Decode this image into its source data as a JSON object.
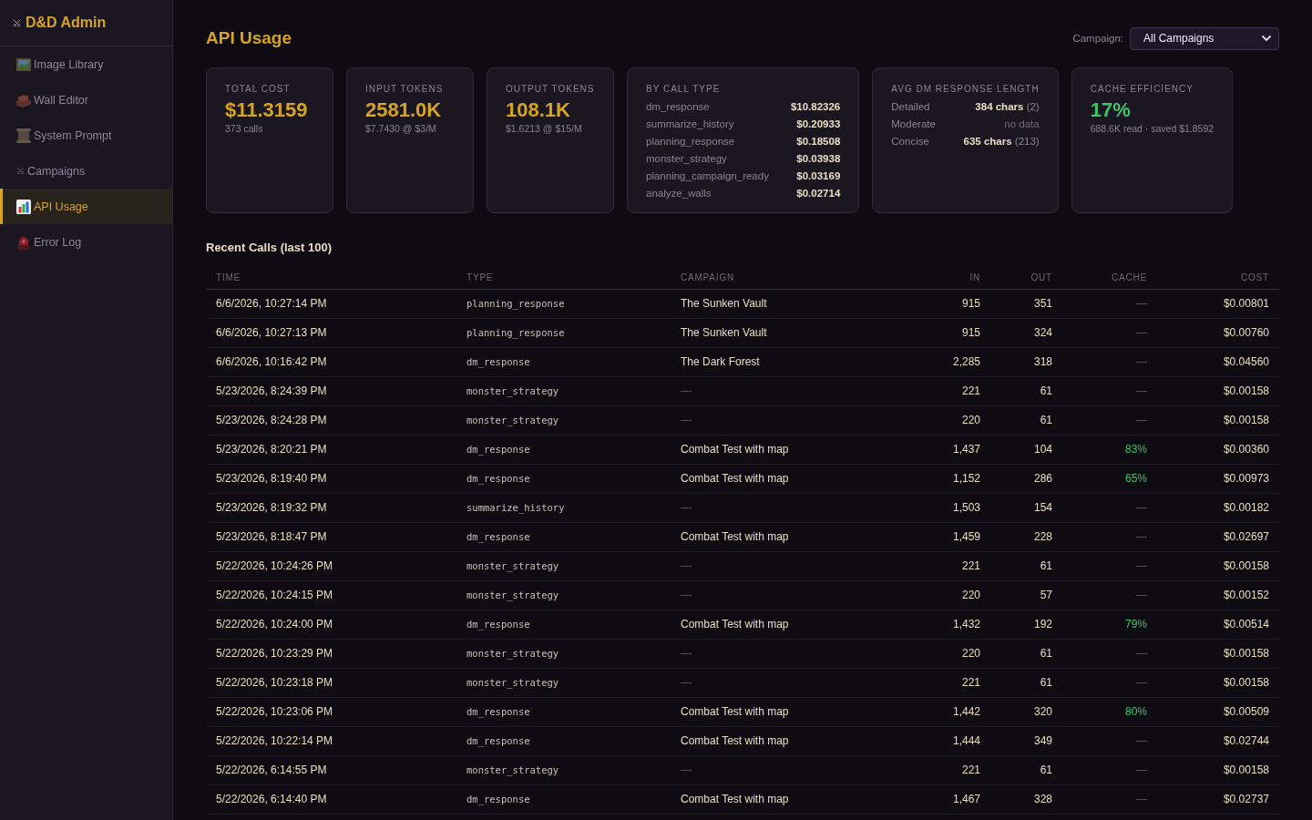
{
  "sidebar": {
    "brand": "D&D Admin",
    "items": [
      {
        "label": "Image Library",
        "selected": false
      },
      {
        "label": "Wall Editor",
        "selected": false
      },
      {
        "label": "System Prompt",
        "selected": false
      },
      {
        "label": "Campaigns",
        "selected": false
      },
      {
        "label": "API Usage",
        "selected": true
      },
      {
        "label": "Error Log",
        "selected": false
      }
    ]
  },
  "header": {
    "title": "API Usage",
    "campaign_filter": {
      "label": "Campaign:",
      "value": "All Campaigns"
    }
  },
  "stats": [
    {
      "kind": "metric",
      "label": "TOTAL COST",
      "value": "$11.3159",
      "note": "373 calls",
      "color": "#d6a324"
    },
    {
      "kind": "metric",
      "label": "INPUT TOKENS",
      "value": "2581.0K",
      "note": "$7.7430 @ $3/M",
      "color": "#d6a324"
    },
    {
      "kind": "metric",
      "label": "OUTPUT TOKENS",
      "value": "108.1K",
      "note": "$1.6213 @ $15/M",
      "color": "#d6a324"
    },
    {
      "kind": "breakdown",
      "label": "BY CALL TYPE",
      "rows": [
        {
          "name": "dm_response",
          "cost": "$10.82326"
        },
        {
          "name": "summarize_history",
          "cost": "$0.20933"
        },
        {
          "name": "planning_response",
          "cost": "$0.18508"
        },
        {
          "name": "monster_strategy",
          "cost": "$0.03938"
        },
        {
          "name": "planning_campaign_ready",
          "cost": "$0.03169"
        },
        {
          "name": "analyze_walls",
          "cost": "$0.02714"
        }
      ]
    },
    {
      "kind": "lengths",
      "label": "AVG DM RESPONSE LENGTH",
      "rows": [
        {
          "name": "Detailed",
          "value": "384 chars",
          "count": "(2)",
          "has_data": true
        },
        {
          "name": "Moderate",
          "value": "no data",
          "has_data": false
        },
        {
          "name": "Concise",
          "value": "635 chars",
          "count": "(213)",
          "has_data": true
        }
      ]
    },
    {
      "kind": "metric",
      "label": "CACHE EFFICIENCY",
      "value": "17%",
      "note": "688.6K read · saved $1.8592",
      "color": "#3ec46d"
    }
  ],
  "recent_calls": {
    "title": "Recent Calls (last 100)",
    "columns": [
      "TIME",
      "TYPE",
      "CAMPAIGN",
      "IN",
      "OUT",
      "CACHE",
      "COST"
    ],
    "rows": [
      {
        "time": "6/6/2026, 10:27:14 PM",
        "type": "planning_response",
        "campaign": "The Sunken Vault",
        "has_campaign": true,
        "in": "915",
        "out": "351",
        "cache": "—",
        "cache_hit": false,
        "cost": "$0.00801"
      },
      {
        "time": "6/6/2026, 10:27:13 PM",
        "type": "planning_response",
        "campaign": "The Sunken Vault",
        "has_campaign": true,
        "in": "915",
        "out": "324",
        "cache": "—",
        "cache_hit": false,
        "cost": "$0.00760"
      },
      {
        "time": "6/6/2026, 10:16:42 PM",
        "type": "dm_response",
        "campaign": "The Dark Forest",
        "has_campaign": true,
        "in": "2,285",
        "out": "318",
        "cache": "—",
        "cache_hit": false,
        "cost": "$0.04560"
      },
      {
        "time": "5/23/2026, 8:24:39 PM",
        "type": "monster_strategy",
        "campaign": "—",
        "has_campaign": false,
        "in": "221",
        "out": "61",
        "cache": "—",
        "cache_hit": false,
        "cost": "$0.00158"
      },
      {
        "time": "5/23/2026, 8:24:28 PM",
        "type": "monster_strategy",
        "campaign": "—",
        "has_campaign": false,
        "in": "220",
        "out": "61",
        "cache": "—",
        "cache_hit": false,
        "cost": "$0.00158"
      },
      {
        "time": "5/23/2026, 8:20:21 PM",
        "type": "dm_response",
        "campaign": "Combat Test with map",
        "has_campaign": true,
        "in": "1,437",
        "out": "104",
        "cache": "83%",
        "cache_hit": true,
        "cost": "$0.00360"
      },
      {
        "time": "5/23/2026, 8:19:40 PM",
        "type": "dm_response",
        "campaign": "Combat Test with map",
        "has_campaign": true,
        "in": "1,152",
        "out": "286",
        "cache": "65%",
        "cache_hit": true,
        "cost": "$0.00973"
      },
      {
        "time": "5/23/2026, 8:19:32 PM",
        "type": "summarize_history",
        "campaign": "—",
        "has_campaign": false,
        "in": "1,503",
        "out": "154",
        "cache": "—",
        "cache_hit": false,
        "cost": "$0.00182"
      },
      {
        "time": "5/23/2026, 8:18:47 PM",
        "type": "dm_response",
        "campaign": "Combat Test with map",
        "has_campaign": true,
        "in": "1,459",
        "out": "228",
        "cache": "—",
        "cache_hit": false,
        "cost": "$0.02697"
      },
      {
        "time": "5/22/2026, 10:24:26 PM",
        "type": "monster_strategy",
        "campaign": "—",
        "has_campaign": false,
        "in": "221",
        "out": "61",
        "cache": "—",
        "cache_hit": false,
        "cost": "$0.00158"
      },
      {
        "time": "5/22/2026, 10:24:15 PM",
        "type": "monster_strategy",
        "campaign": "—",
        "has_campaign": false,
        "in": "220",
        "out": "57",
        "cache": "—",
        "cache_hit": false,
        "cost": "$0.00152"
      },
      {
        "time": "5/22/2026, 10:24:00 PM",
        "type": "dm_response",
        "campaign": "Combat Test with map",
        "has_campaign": true,
        "in": "1,432",
        "out": "192",
        "cache": "79%",
        "cache_hit": true,
        "cost": "$0.00514"
      },
      {
        "time": "5/22/2026, 10:23:29 PM",
        "type": "monster_strategy",
        "campaign": "—",
        "has_campaign": false,
        "in": "220",
        "out": "61",
        "cache": "—",
        "cache_hit": false,
        "cost": "$0.00158"
      },
      {
        "time": "5/22/2026, 10:23:18 PM",
        "type": "monster_strategy",
        "campaign": "—",
        "has_campaign": false,
        "in": "221",
        "out": "61",
        "cache": "—",
        "cache_hit": false,
        "cost": "$0.00158"
      },
      {
        "time": "5/22/2026, 10:23:06 PM",
        "type": "dm_response",
        "campaign": "Combat Test with map",
        "has_campaign": true,
        "in": "1,442",
        "out": "320",
        "cache": "80%",
        "cache_hit": true,
        "cost": "$0.00509"
      },
      {
        "time": "5/22/2026, 10:22:14 PM",
        "type": "dm_response",
        "campaign": "Combat Test with map",
        "has_campaign": true,
        "in": "1,444",
        "out": "349",
        "cache": "—",
        "cache_hit": false,
        "cost": "$0.02744"
      },
      {
        "time": "5/22/2026, 6:14:55 PM",
        "type": "monster_strategy",
        "campaign": "—",
        "has_campaign": false,
        "in": "221",
        "out": "61",
        "cache": "—",
        "cache_hit": false,
        "cost": "$0.00158"
      },
      {
        "time": "5/22/2026, 6:14:40 PM",
        "type": "dm_response",
        "campaign": "Combat Test with map",
        "has_campaign": true,
        "in": "1,467",
        "out": "328",
        "cache": "—",
        "cache_hit": false,
        "cost": "$0.02737"
      }
    ]
  }
}
